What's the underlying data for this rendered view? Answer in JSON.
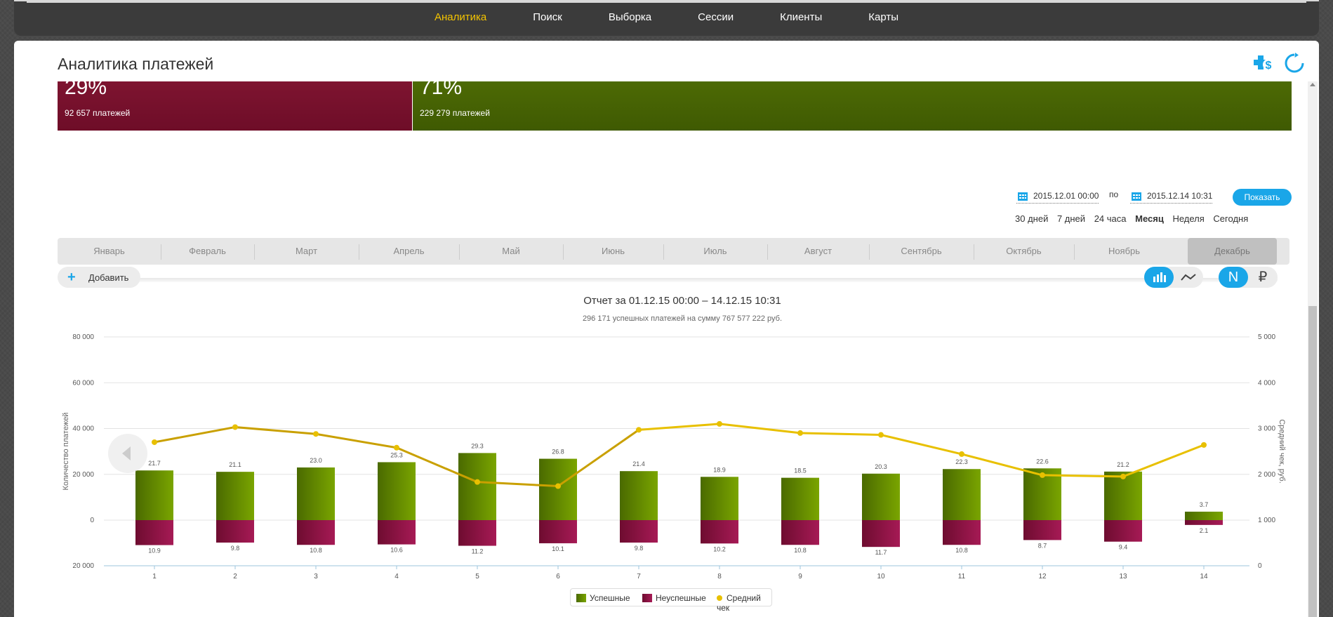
{
  "nav": {
    "items": [
      "Аналитика",
      "Поиск",
      "Выборка",
      "Сессии",
      "Клиенты",
      "Карты"
    ],
    "active_index": 0,
    "active_color": "#f4c400"
  },
  "page": {
    "title": "Аналитика платежей",
    "header_icons": [
      "add-payment-icon",
      "refresh-icon"
    ]
  },
  "summary": {
    "fail_pct": "29%",
    "fail_count": "92 657 платежей",
    "ok_pct": "71%",
    "ok_count": "229 279 платежей",
    "fail_color": "#7a1230",
    "ok_color": "#4a6604"
  },
  "filter": {
    "date_from": "2015.12.01 00:00",
    "separator": "по",
    "date_to": "2015.12.14 10:31",
    "show_label": "Показать",
    "periods": [
      "30 дней",
      "7 дней",
      "24 часа",
      "Месяц",
      "Неделя",
      "Сегодня"
    ],
    "active_period": "Месяц"
  },
  "months": {
    "items": [
      "Январь",
      "Февраль",
      "Март",
      "Апрель",
      "Май",
      "Июнь",
      "Июль",
      "Август",
      "Сентябрь",
      "Октябрь",
      "Ноябрь",
      "Декабрь"
    ],
    "selected": "Декабрь"
  },
  "toolbar": {
    "add_label": "Добавить",
    "chart_type_options": [
      "bar-chart-icon",
      "line-chart-icon"
    ],
    "chart_type_selected": "bar-chart-icon",
    "measure_options": [
      "N",
      "₽"
    ],
    "measure_selected": "N"
  },
  "report": {
    "title": "Отчет за 01.12.15 00:00 – 14.12.15 10:31",
    "subtitle": "296 171 успешных платежей на сумму 767 577 222 руб."
  },
  "chart_data": {
    "type": "bar",
    "categories": [
      "1",
      "2",
      "3",
      "4",
      "5",
      "6",
      "7",
      "8",
      "9",
      "10",
      "11",
      "12",
      "13",
      "14"
    ],
    "ylabel": "Количество платежей",
    "y2label": "Средний чек, руб.",
    "y_ticks": [
      "80 000",
      "60 000",
      "40 000",
      "20 000",
      "0",
      "20 000"
    ],
    "y2_ticks": [
      "5 000",
      "4 000",
      "3 000",
      "2 000",
      "1 000",
      "0"
    ],
    "ylim": [
      -20000,
      80000
    ],
    "y2lim": [
      0,
      5000
    ],
    "grid": true,
    "legend_position": "bottom",
    "series": [
      {
        "name": "Успешные",
        "color": "#5a7d00",
        "values": [
          21.7,
          21.1,
          23.0,
          25.3,
          29.3,
          26.8,
          21.4,
          18.9,
          18.5,
          20.3,
          22.3,
          22.6,
          21.2,
          3.7
        ],
        "labels": [
          "21.7",
          "21.1",
          "23.0",
          "25.3",
          "29.3",
          "26.8",
          "21.4",
          "18.9",
          "18.5",
          "20.3",
          "22.3",
          "22.6",
          "21.2",
          "3.7"
        ],
        "unit_multiplier": 1000
      },
      {
        "name": "Неуспешные",
        "color": "#8a1540",
        "values": [
          10.9,
          9.8,
          10.8,
          10.6,
          11.2,
          10.1,
          9.8,
          10.2,
          10.8,
          11.7,
          10.8,
          8.7,
          9.4,
          2.1
        ],
        "labels": [
          "10.9",
          "9.8",
          "10.8",
          "10.6",
          "11.2",
          "10.1",
          "9.8",
          "10.2",
          "10.8",
          "11.7",
          "10.8",
          "8.7",
          "9.4",
          "2.1"
        ],
        "unit_multiplier": 1000
      },
      {
        "name": "Средний чек",
        "color": "#e8c000",
        "axis": "right",
        "values": [
          2700,
          3030,
          2880,
          2580,
          1830,
          1740,
          2970,
          3100,
          2900,
          2860,
          2440,
          1980,
          1950,
          2640
        ]
      }
    ]
  }
}
